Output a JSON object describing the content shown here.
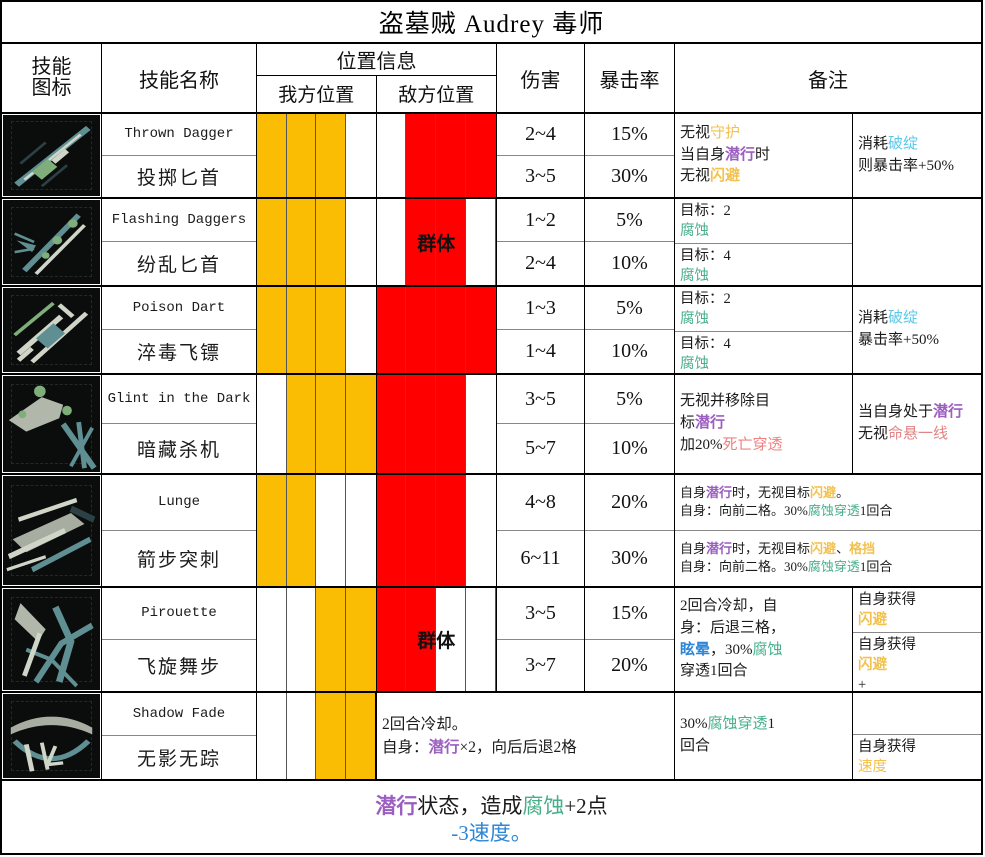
{
  "title": "盗墓贼 Audrey 毒师",
  "header": {
    "icon": [
      "技能",
      "图标"
    ],
    "name": "技能名称",
    "position_group": "位置信息",
    "ally_position": "我方位置",
    "enemy_position": "敌方位置",
    "damage": "伤害",
    "crit": "暴击率",
    "remark": "备注"
  },
  "colors": {
    "ally_cell": "#FBBC04",
    "enemy_cell": "#FF0000",
    "stealth": "#9B5FC0",
    "blight": "#49AF8B",
    "dodge": "#F2C14E",
    "guard": "#F2C14E",
    "riposte": "#5BC8E8",
    "stun": "#2E86D6",
    "deathblow": "#F08080",
    "damage_red": "#E03030"
  },
  "aoe_label": "群体",
  "skills": [
    {
      "icon": "thrown-dagger-icon",
      "name_en": "Thrown Dagger",
      "name_cn": "投掷匕首",
      "ally": [
        1,
        1,
        1,
        0
      ],
      "enemy": [
        0,
        1,
        1,
        1
      ],
      "aoe": false,
      "damage": [
        "2~4",
        "3~5"
      ],
      "damage_red": [
        false,
        false
      ],
      "crit": [
        "15%",
        "30%"
      ],
      "remark_a_lines": [
        "无视守护",
        "当自身潜行时",
        "无视闪避"
      ],
      "remark_b_lines": [
        "消耗破绽",
        "则暴击率+50%"
      ]
    },
    {
      "icon": "flashing-daggers-icon",
      "name_en": "Flashing Daggers",
      "name_cn": "纷乱匕首",
      "ally": [
        1,
        1,
        1,
        0
      ],
      "enemy": [
        0,
        1,
        1,
        0
      ],
      "aoe": true,
      "damage": [
        "1~2",
        "2~4"
      ],
      "damage_red": [
        false,
        false
      ],
      "crit": [
        "5%",
        "10%"
      ],
      "remark_a_split": [
        "目标：2腐蚀",
        "目标：4腐蚀"
      ],
      "remark_b_lines": []
    },
    {
      "icon": "poison-dart-icon",
      "name_en": "Poison Dart",
      "name_cn": "淬毒飞镖",
      "ally": [
        1,
        1,
        1,
        0
      ],
      "enemy": [
        1,
        1,
        1,
        1
      ],
      "aoe": false,
      "damage": [
        "1~3",
        "1~4"
      ],
      "damage_red": [
        false,
        false
      ],
      "crit": [
        "5%",
        "10%"
      ],
      "remark_a_split": [
        "目标：2腐蚀",
        "目标：4腐蚀"
      ],
      "remark_b_lines": [
        "消耗破绽",
        "暴击率+50%"
      ]
    },
    {
      "icon": "glint-in-the-dark-icon",
      "name_en": "Glint in the Dark",
      "name_cn": "暗藏杀机",
      "ally": [
        0,
        1,
        1,
        1
      ],
      "enemy": [
        1,
        1,
        1,
        0
      ],
      "aoe": false,
      "damage": [
        "3~5",
        "5~7"
      ],
      "damage_red": [
        true,
        true
      ],
      "crit": [
        "5%",
        "10%"
      ],
      "remark_a_lines": [
        "无视并移除目",
        "标潜行",
        "加20%死亡穿透"
      ],
      "remark_b_lines": [
        "当自身处于潜行",
        "无视命悬一线"
      ]
    },
    {
      "icon": "lunge-icon",
      "name_en": "Lunge",
      "name_cn": "箭步突刺",
      "ally": [
        1,
        1,
        0,
        0
      ],
      "enemy": [
        1,
        1,
        1,
        0
      ],
      "aoe": false,
      "damage": [
        "4~8",
        "6~11"
      ],
      "damage_red": [
        false,
        true
      ],
      "crit": [
        "20%",
        "30%"
      ],
      "remark_full_top": [
        "自身潜行时，无视目标闪避。",
        "自身：向前二格。30%腐蚀穿透1回合"
      ],
      "remark_full_bot": [
        "自身潜行时，无视目标闪避、格挡",
        "自身：向前二格。30%腐蚀穿透1回合"
      ]
    },
    {
      "icon": "pirouette-icon",
      "name_en": "Pirouette",
      "name_cn": "飞旋舞步",
      "ally": [
        0,
        0,
        1,
        1
      ],
      "enemy": [
        1,
        1,
        0,
        0
      ],
      "aoe": true,
      "damage": [
        "3~5",
        "3~7"
      ],
      "damage_red": [
        false,
        false
      ],
      "crit": [
        "15%",
        "20%"
      ],
      "remark_a_lines": [
        "2回合冷却，自",
        "身：后退三格，",
        "眩晕，30%腐蚀",
        "穿透1回合"
      ],
      "remark_b_split": [
        "自身获得闪避",
        "自身获得闪避+"
      ]
    },
    {
      "icon": "shadow-fade-icon",
      "name_en": "Shadow Fade",
      "name_cn": "无影无踪",
      "ally": [
        0,
        0,
        1,
        1
      ],
      "enemy": [
        0,
        0,
        0,
        0
      ],
      "aoe": false,
      "merged_note": [
        "2回合冷却。",
        "自身：潜行×2，向后后退2格"
      ],
      "remark_a_lines": [
        "30%腐蚀穿透1",
        "回合"
      ],
      "remark_b_split": [
        "",
        "自身获得速度"
      ]
    }
  ],
  "footer": {
    "line1": "潜行状态，造成腐蚀+2点",
    "line2": "-3速度。"
  }
}
